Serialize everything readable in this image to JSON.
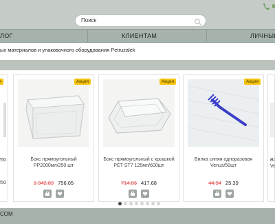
{
  "search": {
    "placeholder": "Поиск"
  },
  "nav": {
    "items": [
      "ЛОГ",
      "КЛИЕНТАМ",
      "ЛИЧНЫЙ"
    ]
  },
  "tagline": "ых материалов и упаковочного оборудования Petruzalek",
  "badge_label": "Акция",
  "left_partial": {
    "name": "250",
    "name2": "250"
  },
  "products": [
    {
      "name": "Бокс прямоугольный PP2000мл/250 шт",
      "old_price": "1 342.89",
      "price": "756.05",
      "badge": true
    },
    {
      "name": "Бокс прямоугольный с крышкой PET ST7 125мл/600шт",
      "old_price": "714.86",
      "price": "417.68",
      "badge": true
    },
    {
      "name": "Вилка синяя одноразовая Venus/50шт",
      "old_price": "44.94",
      "price": "25.39",
      "badge": true
    }
  ],
  "right_partial": {
    "name": "Во",
    "name2": "Ve"
  },
  "carousel": {
    "total": 8,
    "active": 0
  },
  "footer": {
    "text": "COM"
  },
  "colors": {
    "topbar": "#c5cbc6",
    "nav": "#a6b3ac",
    "badge": "#f6c40f",
    "old_price": "#e35050",
    "button": "#9fa6a1"
  }
}
